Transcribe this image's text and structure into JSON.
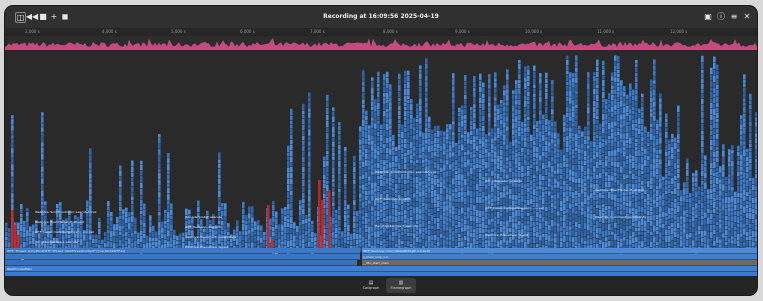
{
  "window": {
    "title": "Recording at 16:09:56 2025-04-19"
  },
  "toolbar_left": [
    {
      "name": "sidebar-toggle-icon",
      "glyph": "◫",
      "boxed": true
    },
    {
      "name": "previous-icon",
      "glyph": "◀◀",
      "boxed": false
    },
    {
      "name": "record-icon",
      "glyph": "■",
      "boxed": false
    },
    {
      "name": "add-icon",
      "glyph": "+",
      "boxed": false
    },
    {
      "name": "stop-icon",
      "glyph": "◼",
      "boxed": false
    }
  ],
  "toolbar_right": [
    {
      "name": "panel-icon",
      "glyph": "▣"
    },
    {
      "name": "info-icon",
      "glyph": "ⓘ"
    },
    {
      "name": "menu-icon",
      "glyph": "≡"
    },
    {
      "name": "close-icon",
      "glyph": "✕"
    }
  ],
  "ruler": {
    "ticks": [
      "2,000 s",
      "4,000 s",
      "5,000 s",
      "6,000 s",
      "7,000 s",
      "8,000 s",
      "9,000 s",
      "10,000 s",
      "11,000 s",
      "12,000 s"
    ]
  },
  "colors": {
    "accent_pink": "#e0508c",
    "flame_blue": "#3a78c8",
    "flame_dark": "#1f3b63",
    "hot_red": "#c82828",
    "hot_yellow": "#e8c028",
    "base_bar": "#3d7fd6"
  },
  "flame_labels": {
    "left": [
      "WebCore::ScriptController::executeScript",
      "JSC::Interpreter::execute",
      "WebCore::EventTarget::fireEvent",
      "WTF::RunLoop::dispatch",
      "WTF::Detail::CallableWrapper<...>::call",
      "WebCore::Document::updateStyle",
      "JSC::JSGlobalObject::execute",
      "WebCore::FrameView::layout"
    ],
    "bottom_left": "WTF::Thread::entryPoint(WTF::Thread::NewThreadContext*) [/usr/lib/libWTF.so]",
    "bottom_right": "WTF::RunLoop::run() [libwebkit2gtk-4.1.so.0]",
    "base_main": "g_main_loop_run",
    "base_start": "__libc_start_main",
    "bottom_row": "WebProcessMain"
  },
  "footer_tabs": [
    {
      "name": "callgraph-tab",
      "icon": "▤",
      "label": "Callgraph",
      "active": false
    },
    {
      "name": "flamegraph-tab",
      "icon": "▥",
      "label": "Flamegraph",
      "active": true
    }
  ]
}
